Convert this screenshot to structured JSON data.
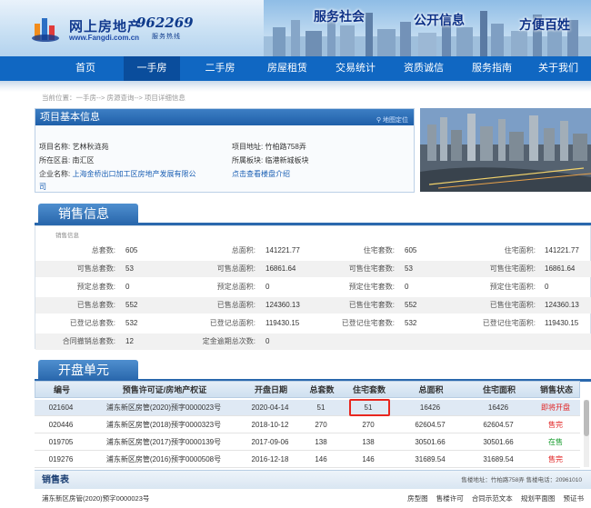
{
  "header": {
    "logo_text": "网上房地产",
    "logo_url": "www.Fangdi.com.cn",
    "hotline_number": "962269",
    "hotline_label": "服务热线",
    "slogans": [
      "服务社会",
      "公开信息",
      "方便百姓"
    ]
  },
  "nav": {
    "items": [
      "首页",
      "一手房",
      "二手房",
      "房屋租赁",
      "交易统计",
      "资质诚信",
      "服务指南",
      "关于我们"
    ],
    "active": "一手房",
    "active_color": "#0a4d9c",
    "bar_color": "#1067c2"
  },
  "breadcrumb": "当前位置：一手房--> 房源查询--> 项目详细信息",
  "project": {
    "title": "项目基本信息",
    "map_link": "地图定位",
    "name_label": "项目名称:",
    "name": "艺林秋涟苑",
    "address_label": "项目地址:",
    "address": "竹柏路758弄",
    "district_label": "所在区县:",
    "district": "南汇区",
    "area_label": "所属板块:",
    "area": "临港新城板块",
    "developer_label": "企业名称:",
    "developer_line1": "上海金桥出口加工区房地产发展有限公",
    "developer_line2": "司",
    "intro_link": "点击查看楼盘介绍"
  },
  "sales_info": {
    "title": "销售信息",
    "subtitle": "销售信息",
    "rows": [
      [
        [
          "总套数:",
          "605"
        ],
        [
          "总面积:",
          "141221.77"
        ],
        [
          "住宅套数:",
          "605"
        ],
        [
          "住宅面积:",
          "141221.77"
        ]
      ],
      [
        [
          "可售总套数:",
          "53"
        ],
        [
          "可售总面积:",
          "16861.64"
        ],
        [
          "可售住宅套数:",
          "53"
        ],
        [
          "可售住宅面积:",
          "16861.64"
        ]
      ],
      [
        [
          "预定总套数:",
          "0"
        ],
        [
          "预定总面积:",
          "0"
        ],
        [
          "预定住宅套数:",
          "0"
        ],
        [
          "预定住宅面积:",
          "0"
        ]
      ],
      [
        [
          "已售总套数:",
          "552"
        ],
        [
          "已售总面积:",
          "124360.13"
        ],
        [
          "已售住宅套数:",
          "552"
        ],
        [
          "已售住宅面积:",
          "124360.13"
        ]
      ],
      [
        [
          "已登记总套数:",
          "532"
        ],
        [
          "已登记总面积:",
          "119430.15"
        ],
        [
          "已登记住宅套数:",
          "532"
        ],
        [
          "已登记住宅面积:",
          "119430.15"
        ]
      ],
      [
        [
          "合同撤销总套数:",
          "12"
        ],
        [
          "定金逾期总次数:",
          "0"
        ]
      ]
    ]
  },
  "units": {
    "title": "开盘单元",
    "headers": [
      "编号",
      "预售许可证/房地产权证",
      "开盘日期",
      "总套数",
      "住宅套数",
      "总面积",
      "住宅面积",
      "销售状态"
    ],
    "rows": [
      {
        "id": "021604",
        "permit": "浦东新区房管(2020)预字0000023号",
        "date": "2020-04-14",
        "total": "51",
        "res": "51",
        "area": "16426",
        "res_area": "16426",
        "status": "即将开盘",
        "status_type": "red"
      },
      {
        "id": "020446",
        "permit": "浦东新区房管(2018)预字0000323号",
        "date": "2018-10-12",
        "total": "270",
        "res": "270",
        "area": "62604.57",
        "res_area": "62604.57",
        "status": "售完",
        "status_type": "red"
      },
      {
        "id": "019705",
        "permit": "浦东新区房管(2017)预字0000139号",
        "date": "2017-09-06",
        "total": "138",
        "res": "138",
        "area": "30501.66",
        "res_area": "30501.66",
        "status": "在售",
        "status_type": "green"
      },
      {
        "id": "019276",
        "permit": "浦东新区房管(2016)预字0000508号",
        "date": "2016-12-18",
        "total": "146",
        "res": "146",
        "area": "31689.54",
        "res_area": "31689.54",
        "status": "售完",
        "status_type": "red"
      }
    ]
  },
  "sales_table": {
    "title": "销售表",
    "info": "售楼地址：竹柏路758弄 售楼电话：20961010",
    "permit": "浦东新区房管(2020)预字0000023号",
    "links": [
      "房型图",
      "售楼许可",
      "合同示范文本",
      "规划平面图",
      "预证书"
    ]
  }
}
